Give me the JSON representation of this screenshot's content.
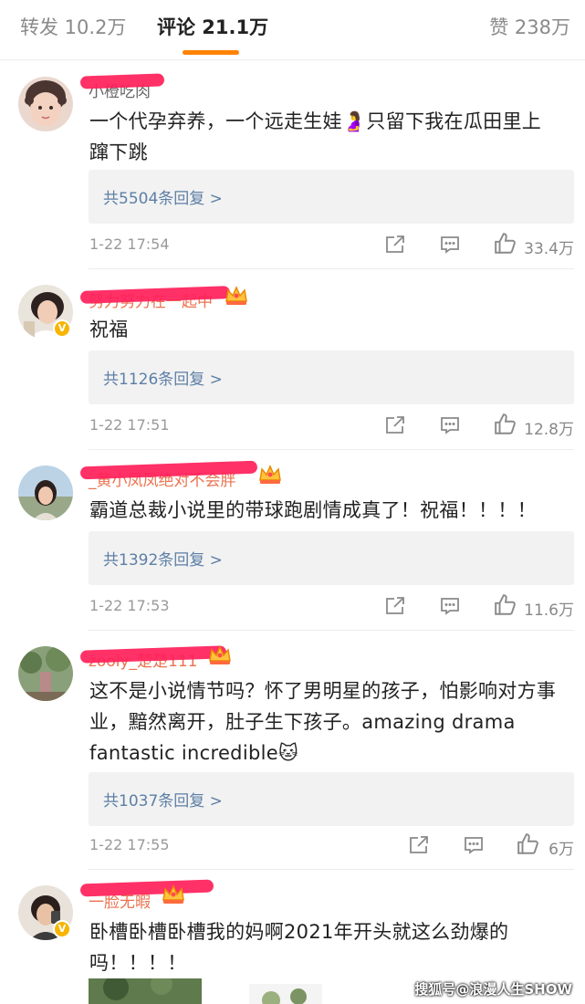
{
  "tabs": {
    "repost": "转发 10.2万",
    "comments": "评论 21.1万",
    "likes": "赞 238万"
  },
  "colors": {
    "accent": "#ff8200",
    "link": "#5d7fa6",
    "username": "#eb7350",
    "scribble": "#ff1f5a",
    "vip_badge": "#f7b500"
  },
  "comments": [
    {
      "username": "小橙吃肉",
      "text": "一个代孕弃养，一个远走生娃🤰只留下我在瓜田里上蹿下跳",
      "replies": "共5504条回复 >",
      "time": "1-22 17:54",
      "likes": "33.4万"
    },
    {
      "username": "努力努力在一起中",
      "text": "祝福",
      "replies": "共1126条回复 >",
      "time": "1-22 17:51",
      "likes": "12.8万"
    },
    {
      "username": "_黄小凤凤绝对不会胖",
      "text": "霸道总裁小说里的带球跑剧情成真了！祝福！！！！",
      "replies": "共1392条回复 >",
      "time": "1-22 17:53",
      "likes": "11.6万"
    },
    {
      "username": "zooly_楚楚111",
      "text": "这不是小说情节吗？怀了男明星的孩子，怕影响对方事业，黯然离开，肚子生下孩子。amazing drama fantastic incredible🐱",
      "replies": "共1037条回复 >",
      "time": "1-22 17:55",
      "likes": "6万"
    },
    {
      "username": "一脸无暇",
      "text": "卧槽卧槽卧槽我的妈啊2021年开头就这么劲爆的吗！！！！"
    }
  ],
  "icons": [
    "share-icon",
    "comment-icon",
    "thumbs-up-icon",
    "crown-icon",
    "verified-v-icon"
  ],
  "watermark": "搜狐号@浪漫人生SHOW",
  "vbadge": "V"
}
